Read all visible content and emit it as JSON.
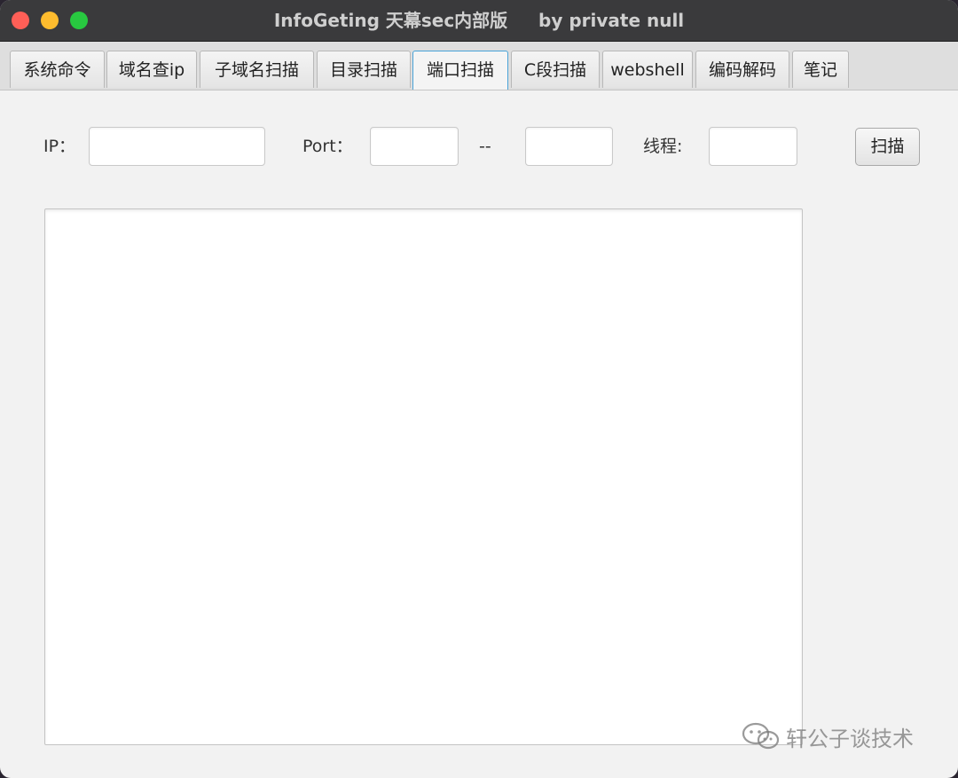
{
  "window": {
    "title": "InfoGeting 天幕sec内部版     by private null"
  },
  "tabs": [
    {
      "label": "系统命令"
    },
    {
      "label": "域名查ip"
    },
    {
      "label": "子域名扫描"
    },
    {
      "label": "目录扫描"
    },
    {
      "label": "端口扫描"
    },
    {
      "label": "C段扫描"
    },
    {
      "label": "webshell"
    },
    {
      "label": "编码解码"
    },
    {
      "label": "笔记"
    }
  ],
  "active_tab": "端口扫描",
  "form": {
    "ip_label": "IP：",
    "ip_value": "",
    "port_label": "Port：",
    "port_start_value": "",
    "port_separator": "--",
    "port_end_value": "",
    "threads_label": "线程:",
    "threads_value": "",
    "scan_button_label": "扫描"
  },
  "output": {
    "text": ""
  },
  "watermark": {
    "text": "轩公子谈技术",
    "icon": "wechat-icon"
  },
  "colors": {
    "titlebar": "#3a3a3c",
    "active_tab_border": "#49a3d8",
    "close": "#fe5f57",
    "minimize": "#febc2e",
    "maximize": "#28c840"
  }
}
